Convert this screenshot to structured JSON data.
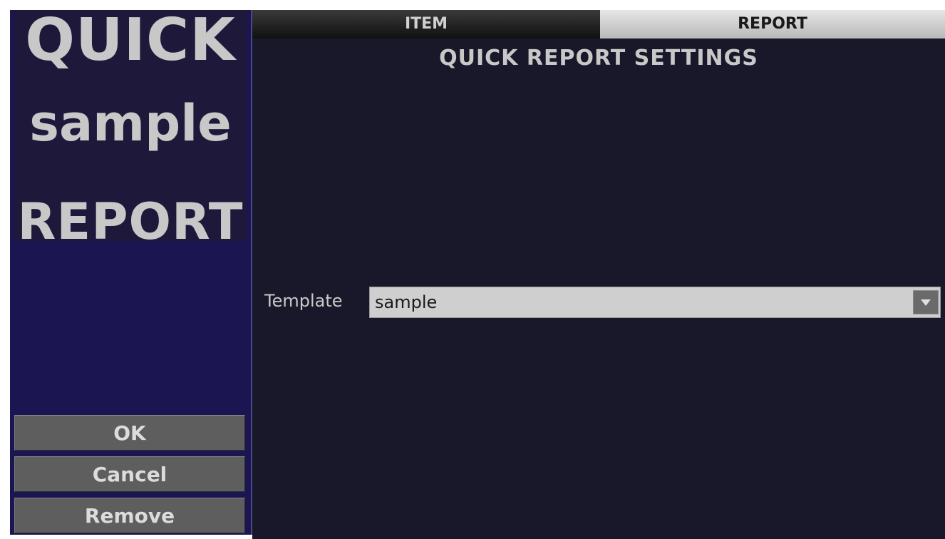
{
  "sidebar": {
    "logo": {
      "line1": "QUICK",
      "line2": "sample",
      "line3": "REPORT"
    },
    "buttons": {
      "ok": "OK",
      "cancel": "Cancel",
      "remove": "Remove"
    }
  },
  "tabs": {
    "item": "ITEM",
    "report": "REPORT",
    "active": "REPORT"
  },
  "main": {
    "title": "QUICK REPORT SETTINGS",
    "template_label": "Template",
    "template_value": "sample"
  },
  "icons": {
    "dropdown": "chevron-down-icon"
  },
  "colors": {
    "sidebar_bg": "#1b1552",
    "main_bg": "#19182a",
    "button_bg": "#5e5e5e",
    "text_light": "#c8c8c8",
    "select_bg": "#cfcfcf"
  }
}
